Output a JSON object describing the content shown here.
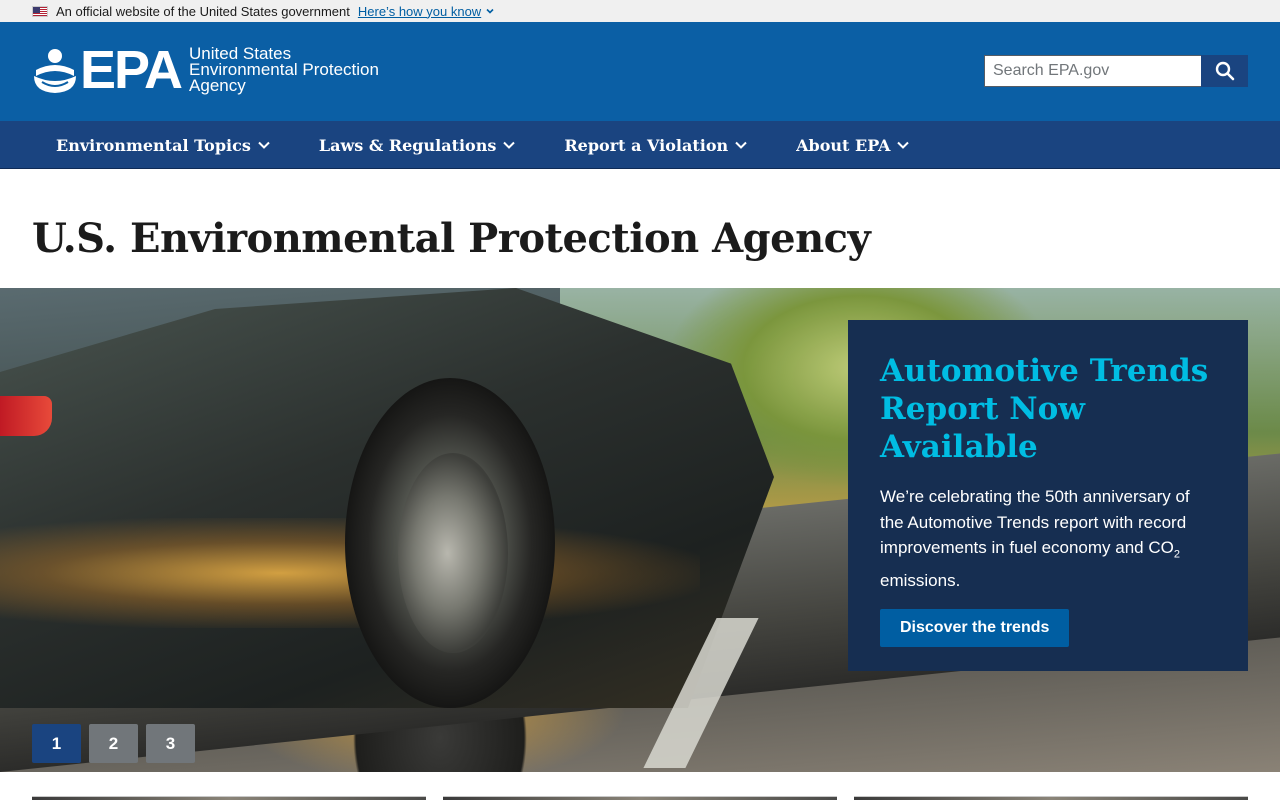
{
  "gov_banner": {
    "text": "An official website of the United States government",
    "link": "Here’s how you know"
  },
  "header": {
    "logo_text": "EPA",
    "agency_lines": [
      "United States",
      "Environmental Protection",
      "Agency"
    ],
    "search_placeholder": "Search EPA.gov"
  },
  "nav": {
    "items": [
      {
        "label": "Environmental Topics"
      },
      {
        "label": "Laws & Regulations"
      },
      {
        "label": "Report a Violation"
      },
      {
        "label": "About EPA"
      }
    ]
  },
  "page": {
    "title": "U.S. Environmental Protection Agency"
  },
  "hero": {
    "title": "Automotive Trends Report Now Available",
    "body_before": "We’re celebrating the 50th anniversary of the Automotive Trends report with record improvements in fuel economy and CO",
    "body_sub": "2",
    "body_after": " emissions.",
    "cta": "Discover the trends",
    "pager": [
      "1",
      "2",
      "3"
    ],
    "active_slide": "1"
  },
  "colors": {
    "header_blue": "#0b5fa5",
    "nav_blue": "#1a4480",
    "card_navy": "#162e51",
    "card_title_cyan": "#00bde3",
    "cta_blue": "#005ea2"
  }
}
